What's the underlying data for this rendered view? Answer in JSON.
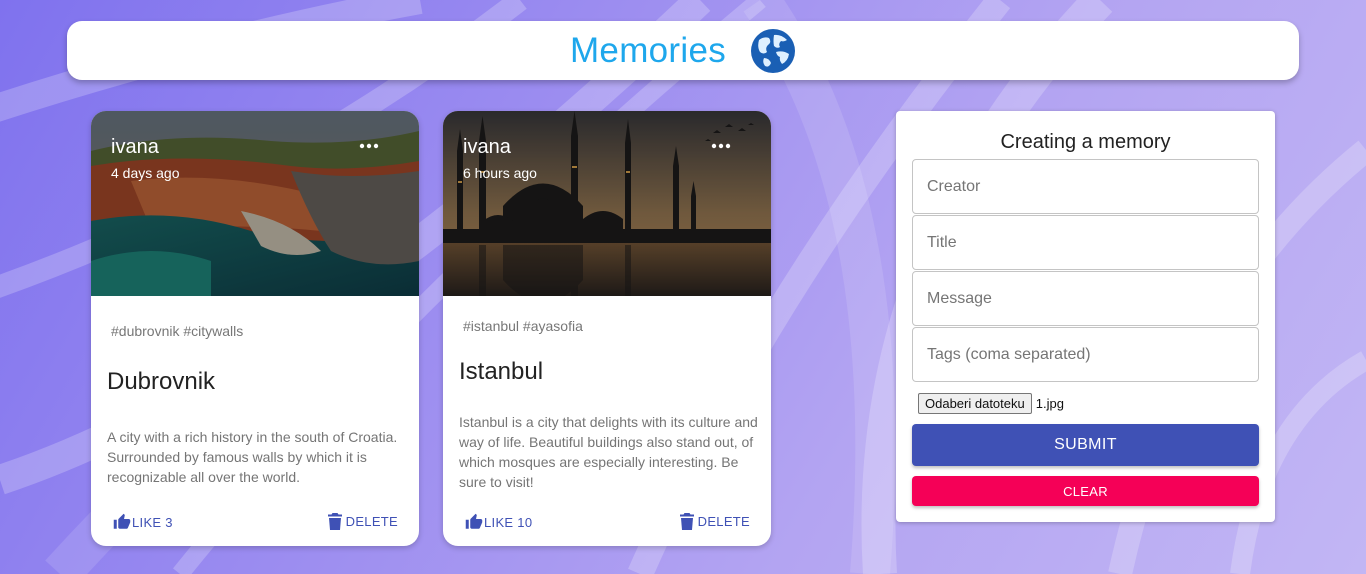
{
  "app": {
    "title": "Memories",
    "logo_icon": "globe-icon",
    "title_color": "#1ea7ec"
  },
  "posts": [
    {
      "creator": "ivana",
      "created_ago": "4 days ago",
      "tags": "#dubrovnik #citywalls",
      "title": "Dubrovnik",
      "message": "A city with a rich history in the south of Croatia. Surrounded by famous walls by which it is recognizable all over the world.",
      "like_label": "LIKE 3",
      "delete_label": "DELETE",
      "image": "dubrovnik-photo"
    },
    {
      "creator": "ivana",
      "created_ago": "6 hours ago",
      "tags": "#istanbul #ayasofia",
      "title": "Istanbul",
      "message": "Istanbul is a city that delights with its culture and way of life. Beautiful buildings also stand out, of which mosques are especially interesting. Be sure to visit!",
      "like_label": "LIKE 10",
      "delete_label": "DELETE",
      "image": "istanbul-photo"
    }
  ],
  "form": {
    "heading": "Creating a memory",
    "creator_placeholder": "Creator",
    "title_placeholder": "Title",
    "message_placeholder": "Message",
    "tags_placeholder": "Tags (coma separated)",
    "file_button_label": "Odaberi datoteku",
    "file_name": "1.jpg",
    "submit_label": "SUBMIT",
    "clear_label": "CLEAR"
  },
  "colors": {
    "primary": "#3f51b5",
    "secondary": "#f50057",
    "background": "#9b8cf0"
  }
}
